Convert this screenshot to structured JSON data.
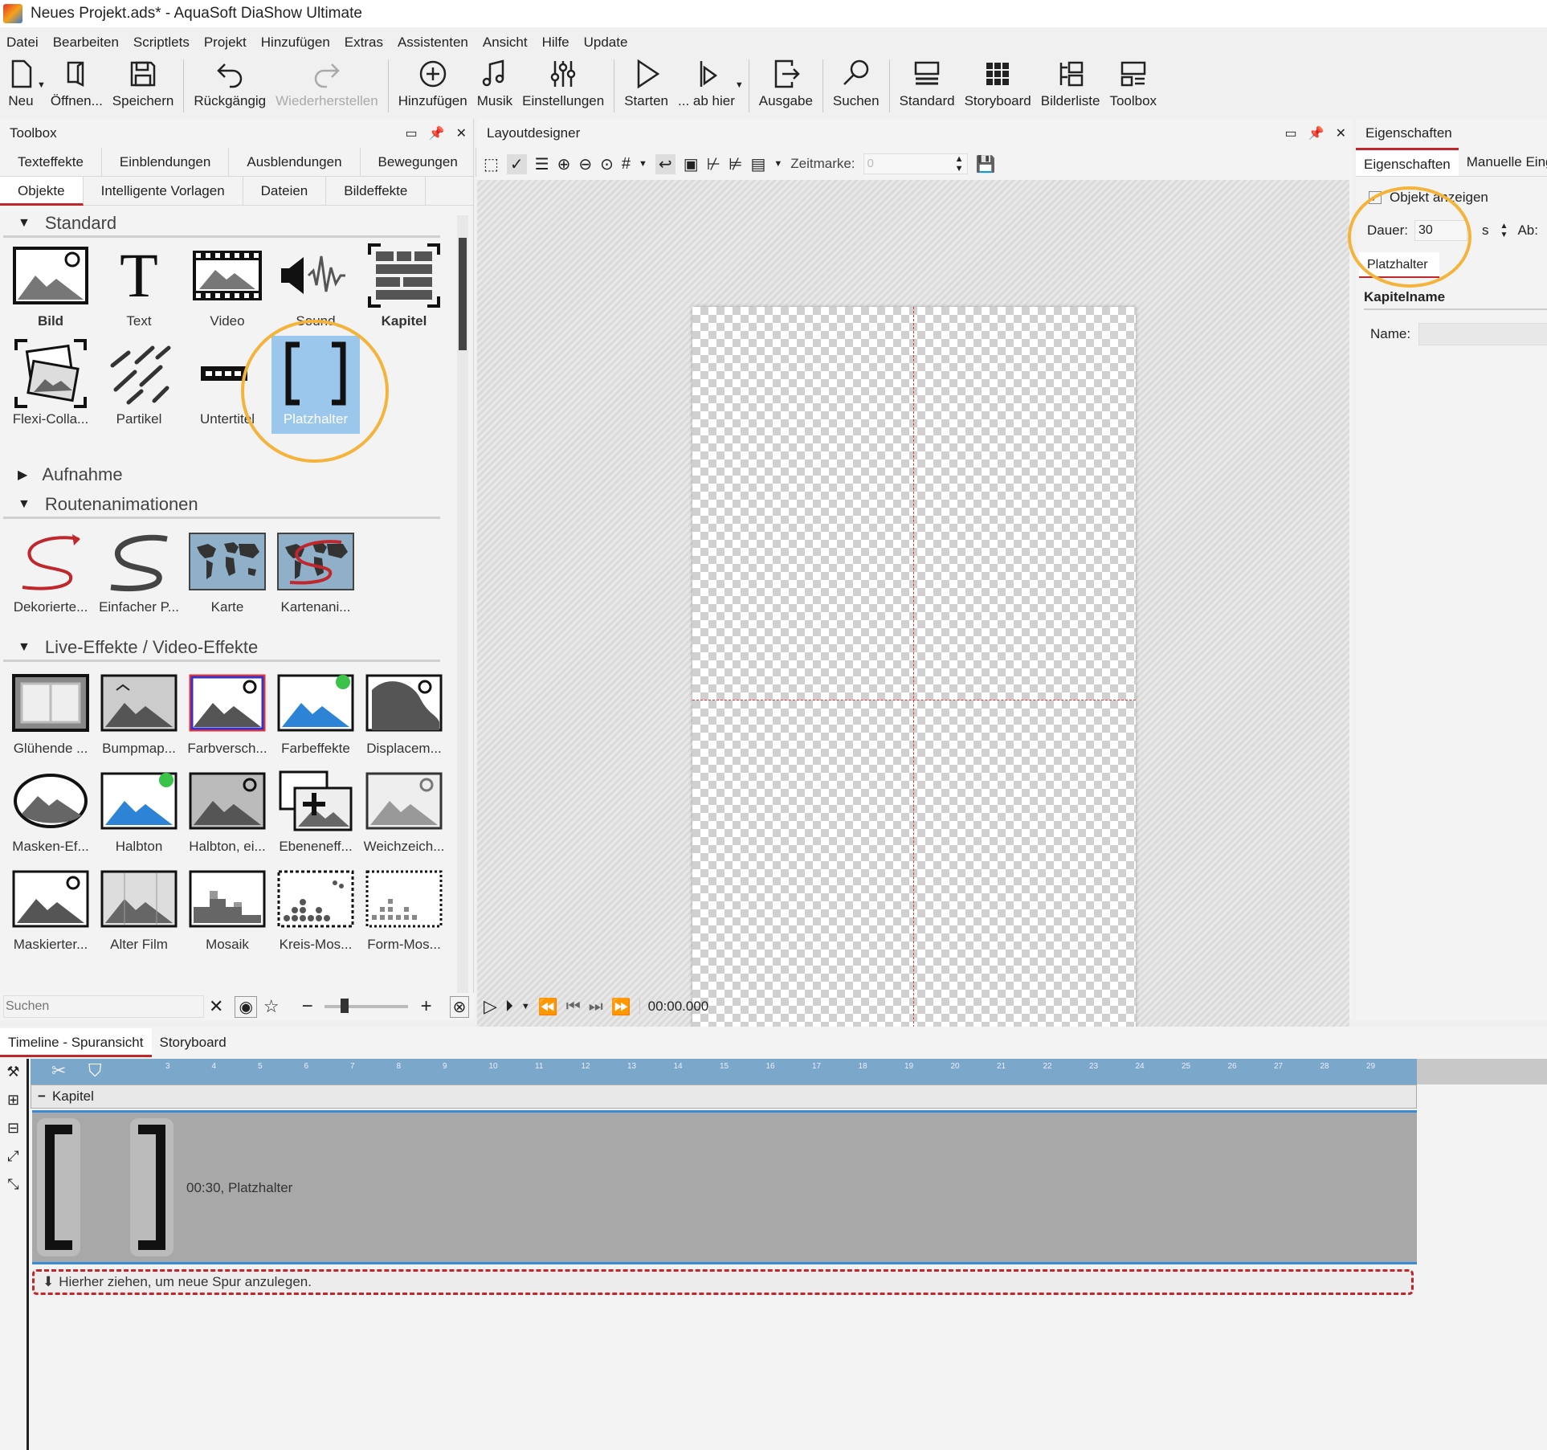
{
  "window": {
    "title": "Neues Projekt.ads* - AquaSoft DiaShow Ultimate"
  },
  "menu": [
    "Datei",
    "Bearbeiten",
    "Scriptlets",
    "Projekt",
    "Hinzufügen",
    "Extras",
    "Assistenten",
    "Ansicht",
    "Hilfe",
    "Update"
  ],
  "toolbar": {
    "neu": "Neu",
    "oeffnen": "Öffnen...",
    "speichern": "Speichern",
    "rueckgaengig": "Rückgängig",
    "wiederherstellen": "Wiederherstellen",
    "hinzufuegen": "Hinzufügen",
    "musik": "Musik",
    "einstellungen": "Einstellungen",
    "starten": "Starten",
    "ab_hier": "... ab hier",
    "ausgabe": "Ausgabe",
    "suchen": "Suchen",
    "standard": "Standard",
    "storyboard": "Storyboard",
    "bilderliste": "Bilderliste",
    "toolbox": "Toolbox"
  },
  "toolbox": {
    "title": "Toolbox",
    "tabs_row1": [
      "Texteffekte",
      "Einblendungen",
      "Ausblendungen",
      "Bewegungen"
    ],
    "tabs_row2": [
      "Objekte",
      "Intelligente Vorlagen",
      "Dateien",
      "Bildeffekte"
    ],
    "sections": {
      "standard": "Standard",
      "aufnahme": "Aufnahme",
      "routen": "Routenanimationen",
      "live": "Live-Effekte / Video-Effekte"
    },
    "standard_items": [
      "Bild",
      "Text",
      "Video",
      "Sound",
      "Kapitel",
      "Flexi-Colla...",
      "Partikel",
      "Untertitel",
      "Platzhalter"
    ],
    "routen_items": [
      "Dekorierte...",
      "Einfacher P...",
      "Karte",
      "Kartenani..."
    ],
    "live_items": [
      "Glühende ...",
      "Bumpmap...",
      "Farbversch...",
      "Farbeffekte",
      "Displacem...",
      "Masken-Ef...",
      "Halbton",
      "Halbton, ei...",
      "Ebeneneff...",
      "Weichzeich...",
      "Maskierter...",
      "Alter Film",
      "Mosaik",
      "Kreis-Mos...",
      "Form-Mos..."
    ],
    "search_placeholder": "Suchen"
  },
  "layout": {
    "title": "Layoutdesigner",
    "zeitmarke_label": "Zeitmarke:",
    "zeitmarke_value": "0",
    "time": "00:00.000"
  },
  "props": {
    "title": "Eigenschaften",
    "tabs": [
      "Eigenschaften",
      "Manuelle Eing"
    ],
    "objekt_anzeigen": "Objekt anzeigen",
    "dauer_label": "Dauer:",
    "dauer_value": "30",
    "dauer_unit": "s",
    "abs": "Ab:",
    "subtab": "Platzhalter",
    "kapitelname": "Kapitelname",
    "name_label": "Name:"
  },
  "timeline": {
    "tabs": [
      "Timeline - Spuransicht",
      "Storyboard"
    ],
    "ruler_ticks": [
      "3",
      "4",
      "5",
      "6",
      "7",
      "8",
      "9",
      "10",
      "11",
      "12",
      "13",
      "14",
      "15",
      "16",
      "17",
      "18",
      "19",
      "20",
      "21",
      "22",
      "23",
      "24",
      "25",
      "26",
      "27",
      "28",
      "29"
    ],
    "chapter": "Kapitel",
    "clip_label": "00:30, Platzhalter",
    "drop_hint": "Hierher ziehen, um neue Spur anzulegen."
  },
  "colors": {
    "accent_red": "#c0272d",
    "highlight_ring": "#f4b43b",
    "selection_blue": "#9bc7ec",
    "ruler_blue": "#7ba7cb"
  }
}
